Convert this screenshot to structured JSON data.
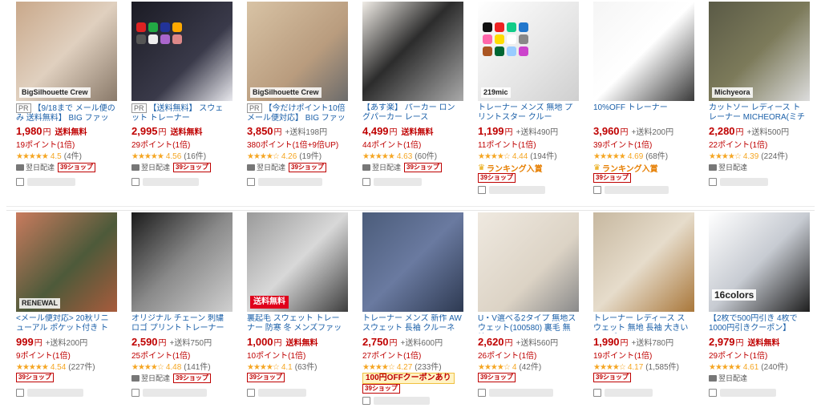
{
  "icons": {
    "delivery": "truck-icon",
    "shop": "shop-icon",
    "ranking": "crown-icon",
    "star": "star-icon"
  },
  "colors": {
    "price": "#bf0000",
    "link": "#1a5fa8",
    "star": "#f5a623",
    "ranking": "#e67e00"
  },
  "labels": {
    "ship_free": "送料無料",
    "delivery": "翌日配達",
    "shop39": "39ショップ",
    "ranking": "ランキング入賞",
    "yen": "円",
    "pr": "PR"
  },
  "products": [
    {
      "pr": true,
      "title": "【9/18まで メール便のみ 送料無料】 BIG ファッション",
      "price": "1,980",
      "shipping": "",
      "ship_free": true,
      "points": "19ポイント(1倍)",
      "rating": "4.5",
      "reviews": "(4件)",
      "stars": "★★★★★",
      "delivery": true,
      "shop39": true,
      "ranking": false,
      "img_bg": "linear-gradient(135deg,#c9a88a 0%,#e0d0bf 50%,#8a7a6a 100%)",
      "img_text": "BigSilhouette Crew",
      "img_text_type": "brand"
    },
    {
      "pr": true,
      "title": "【送料無料】 スウェット トレーナー",
      "price": "2,995",
      "shipping": "",
      "ship_free": true,
      "points": "29ポイント(1倍)",
      "rating": "4.56",
      "reviews": "(16件)",
      "stars": "★★★★★",
      "delivery": true,
      "shop39": true,
      "ranking": false,
      "img_bg": "linear-gradient(135deg,#1b1b24 0%,#3a3a4a 60%,#e9e9ee 100%)",
      "img_text": "",
      "img_text_type": "swatches",
      "swatches": [
        "#d22",
        "#2a4",
        "#239",
        "#fa0",
        "#555",
        "#eee",
        "#a6c",
        "#d88"
      ]
    },
    {
      "pr": true,
      "title": "【今だけポイント10倍 メール便対応】 BIG ファッション",
      "price": "3,850",
      "shipping": "+送料198円",
      "ship_free": false,
      "points": "380ポイント(1倍+9倍UP)",
      "rating": "4.26",
      "reviews": "(19件)",
      "stars": "★★★★☆",
      "delivery": true,
      "shop39": true,
      "ranking": false,
      "img_bg": "linear-gradient(135deg,#d8c3a5 0%,#b99c7e 60%,#6b6b6b 100%)",
      "img_text": "BigSilhouette Crew",
      "img_text_type": "brand"
    },
    {
      "pr": false,
      "title": "【あす楽】 パーカー ロングパーカー レース",
      "price": "4,499",
      "shipping": "",
      "ship_free": true,
      "points": "44ポイント(1倍)",
      "rating": "4.63",
      "reviews": "(60件)",
      "stars": "★★★★★",
      "delivery": true,
      "shop39": true,
      "ranking": false,
      "img_bg": "linear-gradient(135deg,#f0ece6 0%,#2c2c2c 45%,#a9a9a9 100%)",
      "img_text": "",
      "img_text_type": "none"
    },
    {
      "pr": false,
      "title": "トレーナー メンズ 無地 プリントスター クルー",
      "price": "1,199",
      "shipping": "+送料490円",
      "ship_free": false,
      "points": "11ポイント(1倍)",
      "rating": "4.44",
      "reviews": "(194件)",
      "stars": "★★★★☆",
      "delivery": false,
      "shop39": true,
      "ranking": true,
      "img_bg": "linear-gradient(135deg,#ffffff 0%,#e5e5e5 60%,#cfcfcf 100%)",
      "img_text": "219mic",
      "img_text_type": "swatches",
      "swatches": [
        "#111",
        "#e22",
        "#1c8",
        "#27c",
        "#f6a",
        "#fd0",
        "#fff",
        "#888",
        "#a52",
        "#063",
        "#9cf",
        "#c4c"
      ]
    },
    {
      "pr": false,
      "title": "10%OFF トレーナー",
      "price": "3,960",
      "shipping": "+送料200円",
      "ship_free": false,
      "points": "39ポイント(1倍)",
      "rating": "4.69",
      "reviews": "(68件)",
      "stars": "★★★★★",
      "delivery": false,
      "shop39": true,
      "ranking": true,
      "img_bg": "linear-gradient(135deg,#f5f5f5 0%,#ffffff 50%,#3a3a3a 100%)",
      "img_text": "",
      "img_text_type": "none"
    },
    {
      "pr": false,
      "title": "カットソー レディース トレーナー MICHEORA(ミチェラ)",
      "price": "2,280",
      "shipping": "+送料500円",
      "ship_free": false,
      "points": "22ポイント(1倍)",
      "rating": "4.39",
      "reviews": "(224件)",
      "stars": "★★★★☆",
      "delivery": true,
      "shop39": false,
      "ranking": false,
      "img_bg": "linear-gradient(135deg,#5a5a46 0%,#7c7a5a 50%,#dcdcdc 100%)",
      "img_text": "Michyeora",
      "img_text_type": "brand"
    },
    {
      "pr": false,
      "title": "<メール便対応> 20秋リニューアル ポケット付き トレーナー",
      "price": "999",
      "shipping": "+送料200円",
      "ship_free": false,
      "points": "9ポイント(1倍)",
      "rating": "4.54",
      "reviews": "(227件)",
      "stars": "★★★★★",
      "delivery": false,
      "shop39": true,
      "ranking": false,
      "img_bg": "linear-gradient(135deg,#c97b5e 0%,#4d5a3a 55%,#a85b3c 100%)",
      "img_text": "RENEWAL",
      "img_text_type": "brand"
    },
    {
      "pr": false,
      "title": "オリジナル チェーン 刺繍 ロゴ プリント トレーナー",
      "price": "2,590",
      "shipping": "+送料750円",
      "ship_free": false,
      "points": "25ポイント(1倍)",
      "rating": "4.48",
      "reviews": "(141件)",
      "stars": "★★★★☆",
      "delivery": true,
      "shop39": true,
      "ranking": false,
      "img_bg": "linear-gradient(135deg,#1b1b1b 0%,#8a8a8a 50%,#d0d0d0 100%)",
      "img_text": "",
      "img_text_type": "none"
    },
    {
      "pr": false,
      "title": "裏起毛 スウェット トレーナー 防寒 冬 メンズファッション",
      "price": "1,000",
      "shipping": "",
      "ship_free": true,
      "points": "10ポイント(1倍)",
      "rating": "4.1",
      "reviews": "(63件)",
      "stars": "★★★★☆",
      "delivery": false,
      "shop39": true,
      "ranking": false,
      "img_bg": "linear-gradient(135deg,#9a9a9a 0%,#d8d8d8 50%,#3d3d3d 100%)",
      "img_text": "送料無料",
      "img_text_type": "shipfree"
    },
    {
      "pr": false,
      "title": "トレーナー メンズ 新作 AW スウェット 長袖 クルーネック",
      "price": "2,750",
      "shipping": "+送料600円",
      "ship_free": false,
      "points": "27ポイント(1倍)",
      "rating": "4.27",
      "reviews": "(233件)",
      "stars": "★★★★☆",
      "delivery": false,
      "shop39": true,
      "ranking": false,
      "coupon": "100円OFFクーポンあり",
      "img_bg": "linear-gradient(135deg,#4b5c7a 0%,#6a7aa0 50%,#2e3a52 100%)",
      "img_text": "",
      "img_text_type": "none"
    },
    {
      "pr": false,
      "title": "U・V選べる2タイプ 無地スウェット(100580) 裏毛 無地",
      "price": "2,620",
      "shipping": "+送料560円",
      "ship_free": false,
      "points": "26ポイント(1倍)",
      "rating": "4",
      "reviews": "(42件)",
      "stars": "★★★★☆",
      "delivery": false,
      "shop39": true,
      "ranking": false,
      "img_bg": "linear-gradient(135deg,#efe9e0 0%,#dcd3c5 60%,#8a8a8a 100%)",
      "img_text": "",
      "img_text_type": "none"
    },
    {
      "pr": false,
      "title": "トレーナー レディース スウェット 無地 長袖 大きいサイズ",
      "price": "1,990",
      "shipping": "+送料780円",
      "ship_free": false,
      "points": "19ポイント(1倍)",
      "rating": "4.17",
      "reviews": "(1,585件)",
      "stars": "★★★★☆",
      "delivery": false,
      "shop39": true,
      "ranking": false,
      "img_bg": "linear-gradient(135deg,#c7b8a0 0%,#e6dccb 50%,#a9773a 100%)",
      "img_text": "",
      "img_text_type": "none"
    },
    {
      "pr": false,
      "title": "【2枚で500円引き 4枚で1000円引きクーポン】",
      "price": "2,979",
      "shipping": "",
      "ship_free": true,
      "points": "29ポイント(1倍)",
      "rating": "4.61",
      "reviews": "(240件)",
      "stars": "★★★★★",
      "delivery": true,
      "shop39": false,
      "ranking": false,
      "img_bg": "linear-gradient(135deg,#ffffff 0%,#c7cbd2 50%,#1e1e1e 100%)",
      "img_text": "16colors",
      "img_text_type": "colors16"
    }
  ]
}
